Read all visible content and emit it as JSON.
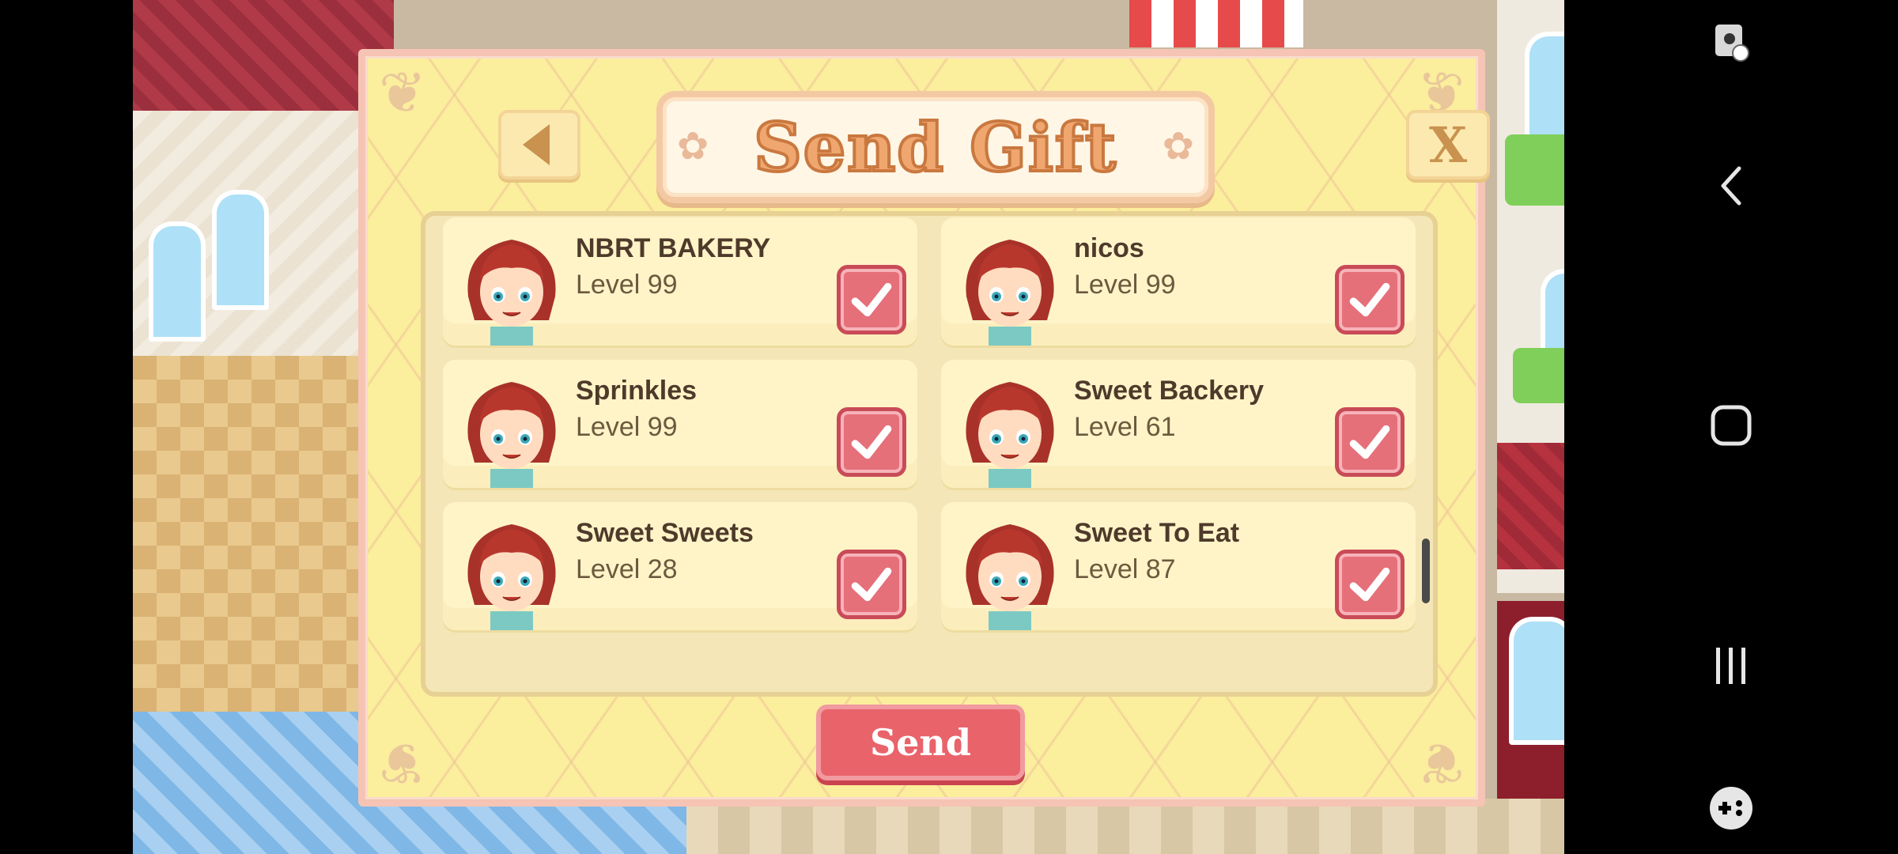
{
  "dialog": {
    "title": "Send Gift",
    "close_label": "X",
    "send_label": "Send"
  },
  "friends": [
    {
      "name": "NBRT BAKERY",
      "level": "Level 99",
      "selected": true
    },
    {
      "name": "nicos",
      "level": "Level 99",
      "selected": true
    },
    {
      "name": "Sprinkles",
      "level": "Level 99",
      "selected": true
    },
    {
      "name": "Sweet Backery",
      "level": "Level 61",
      "selected": true
    },
    {
      "name": "Sweet Sweets",
      "level": "Level 28",
      "selected": true
    },
    {
      "name": "Sweet To Eat",
      "level": "Level 87",
      "selected": true
    }
  ],
  "colors": {
    "panel": "#fbee9d",
    "panel_border": "#f6c4b4",
    "card": "#fff4c8",
    "checkbox": "#e5707a",
    "send_button": "#e9636b",
    "title_text": "#f0a66f"
  },
  "nav_bar": {
    "icons": [
      "assistant-touch-icon",
      "back-arrow-icon",
      "home-square-icon",
      "recents-icon",
      "game-launcher-icon"
    ]
  }
}
